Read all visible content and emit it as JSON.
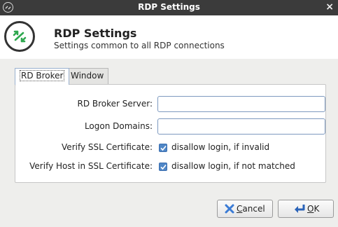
{
  "window": {
    "title": "RDP Settings",
    "close_glyph": "×"
  },
  "header": {
    "title": "RDP Settings",
    "subtitle": "Settings common to all RDP connections",
    "icon": "remote-desktop-icon"
  },
  "tabs": [
    {
      "label": "RD Broker",
      "active": true
    },
    {
      "label": "Window",
      "active": false
    }
  ],
  "form": {
    "broker_server": {
      "label": "RD Broker Server:",
      "value": "",
      "placeholder": ""
    },
    "logon_domains": {
      "label": "Logon Domains:",
      "value": "",
      "placeholder": ""
    },
    "verify_ssl": {
      "label": "Verify SSL Certificate:",
      "checked": true,
      "text": "disallow login, if invalid"
    },
    "verify_host": {
      "label": "Verify Host in SSL Certificate:",
      "checked": true,
      "text": "disallow login, if not matched"
    }
  },
  "buttons": {
    "cancel": {
      "mnemonic": "C",
      "rest": "ancel",
      "icon": "cancel-x-icon"
    },
    "ok": {
      "mnemonic": "O",
      "rest": "K",
      "icon": "return-arrow-icon"
    }
  },
  "colors": {
    "titlebar": "#3b3b3b",
    "accent": "#4f86c6",
    "cancel_icon": "#3a7bd5",
    "ok_icon": "#2a63b8"
  }
}
